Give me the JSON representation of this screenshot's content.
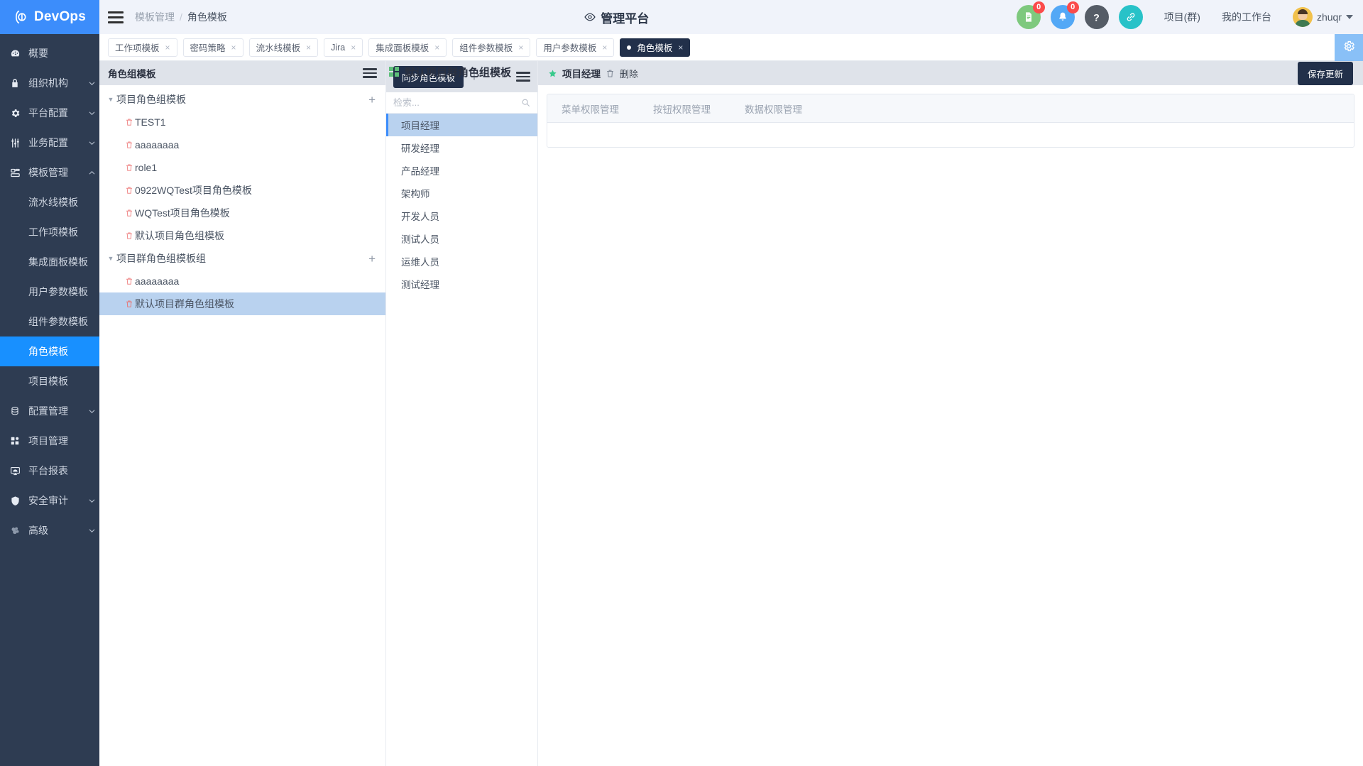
{
  "brand": {
    "name": "DevOps",
    "logo_icon": "devops-logo-icon"
  },
  "header": {
    "menu_icon": "hamburger-icon",
    "breadcrumb": {
      "parent": "模板管理",
      "separator": "/",
      "current": "角色模板"
    },
    "platform_title": "管理平台",
    "platform_icon": "eye-icon",
    "actions": [
      {
        "icon": "document-icon",
        "badge": "0",
        "color": "#7ec97e"
      },
      {
        "icon": "bell-icon",
        "badge": "0",
        "color": "#53a8f6"
      },
      {
        "icon": "question-icon",
        "badge": "",
        "color": "#555c66"
      },
      {
        "icon": "link-icon",
        "badge": "",
        "color": "#28c2c8"
      }
    ],
    "links": [
      "项目(群)",
      "我的工作台"
    ],
    "user": {
      "name": "zhuqr",
      "avatar_icon": "avatar",
      "caret_icon": "chevron-down-icon"
    }
  },
  "sidebar": {
    "items": [
      {
        "label": "概要",
        "icon": "dashboard-icon",
        "arrow": "",
        "level": "top",
        "active": false
      },
      {
        "label": "组织机构",
        "icon": "lock-icon",
        "arrow": "chevron-down-icon",
        "level": "top",
        "active": false
      },
      {
        "label": "平台配置",
        "icon": "gear-icon",
        "arrow": "chevron-down-icon",
        "level": "top",
        "active": false
      },
      {
        "label": "业务配置",
        "icon": "sliders-icon",
        "arrow": "chevron-down-icon",
        "level": "top",
        "active": false
      },
      {
        "label": "模板管理",
        "icon": "template-icon",
        "arrow": "chevron-up-icon",
        "level": "top",
        "active": false
      },
      {
        "label": "流水线模板",
        "icon": "",
        "arrow": "",
        "level": "sub",
        "active": false
      },
      {
        "label": "工作项模板",
        "icon": "",
        "arrow": "",
        "level": "sub",
        "active": false
      },
      {
        "label": "集成面板模板",
        "icon": "",
        "arrow": "",
        "level": "sub",
        "active": false
      },
      {
        "label": "用户参数模板",
        "icon": "",
        "arrow": "",
        "level": "sub",
        "active": false
      },
      {
        "label": "组件参数模板",
        "icon": "",
        "arrow": "",
        "level": "sub",
        "active": false
      },
      {
        "label": "角色模板",
        "icon": "",
        "arrow": "",
        "level": "sub",
        "active": true
      },
      {
        "label": "项目模板",
        "icon": "",
        "arrow": "",
        "level": "sub",
        "active": false
      },
      {
        "label": "配置管理",
        "icon": "database-icon",
        "arrow": "chevron-down-icon",
        "level": "top",
        "active": false
      },
      {
        "label": "项目管理",
        "icon": "grid-icon",
        "arrow": "",
        "level": "top",
        "active": false
      },
      {
        "label": "平台报表",
        "icon": "monitor-icon",
        "arrow": "",
        "level": "top",
        "active": false
      },
      {
        "label": "安全审计",
        "icon": "shield-icon",
        "arrow": "chevron-down-icon",
        "level": "top",
        "active": false
      },
      {
        "label": "高级",
        "icon": "advanced-icon",
        "arrow": "chevron-down-icon",
        "level": "top",
        "active": false
      }
    ]
  },
  "tabstrip": {
    "settings_icon": "gear-icon",
    "tabs": [
      {
        "label": "工作项模板",
        "active": false,
        "closable": true
      },
      {
        "label": "密码策略",
        "active": false,
        "closable": true
      },
      {
        "label": "流水线模板",
        "active": false,
        "closable": true
      },
      {
        "label": "Jira",
        "active": false,
        "closable": true
      },
      {
        "label": "集成面板模板",
        "active": false,
        "closable": true
      },
      {
        "label": "组件参数模板",
        "active": false,
        "closable": true
      },
      {
        "label": "用户参数模板",
        "active": false,
        "closable": true
      },
      {
        "label": "角色模板",
        "active": true,
        "closable": true
      }
    ],
    "close_glyph": "×"
  },
  "tree_pane": {
    "title": "角色组模板",
    "menu_icon": "hamburger-icon",
    "add_glyph": "+",
    "groups": [
      {
        "label": "项目角色组模板",
        "expanded": true,
        "items": [
          {
            "label": "TEST1",
            "selected": false
          },
          {
            "label": "aaaaaaaa",
            "selected": false
          },
          {
            "label": "role1",
            "selected": false
          },
          {
            "label": "0922WQTest项目角色模板",
            "selected": false
          },
          {
            "label": "WQTest项目角色模板",
            "selected": false
          },
          {
            "label": "默认项目角色组模板",
            "selected": false
          }
        ]
      },
      {
        "label": "项目群角色组模板组",
        "expanded": true,
        "items": [
          {
            "label": "aaaaaaaa",
            "selected": false
          },
          {
            "label": "默认项目群角色组模板",
            "selected": true
          }
        ]
      }
    ]
  },
  "section": {
    "icon": "grid-icon",
    "title": "默认项目群角色组模板"
  },
  "role_list": {
    "sync_button": "同步角色模板",
    "add_glyph": "+",
    "menu_icon": "hamburger-icon",
    "search_placeholder": "检索...",
    "search_value": "",
    "search_icon": "search-icon",
    "roles": [
      {
        "label": "项目经理",
        "selected": true
      },
      {
        "label": "研发经理",
        "selected": false
      },
      {
        "label": "产品经理",
        "selected": false
      },
      {
        "label": "架构师",
        "selected": false
      },
      {
        "label": "开发人员",
        "selected": false
      },
      {
        "label": "测试人员",
        "selected": false
      },
      {
        "label": "运维人员",
        "selected": false
      },
      {
        "label": "测试经理",
        "selected": false
      }
    ]
  },
  "detail": {
    "star_icon": "star-icon",
    "role_name": "项目经理",
    "delete_icon": "trash-icon",
    "delete_label": "删除",
    "save_label": "保存更新",
    "tabs": [
      {
        "label": "菜单权限管理",
        "active": true
      },
      {
        "label": "按钮权限管理",
        "active": false
      },
      {
        "label": "数据权限管理",
        "active": false
      }
    ]
  },
  "colors": {
    "brand_blue": "#3c8dfb",
    "sidebar_bg": "#2e3c52",
    "active_nav": "#1890ff",
    "selection": "#b9d2ef",
    "dark_button": "#22304a",
    "badge_red": "#fb4b4b",
    "trash_red": "#f08a8a",
    "star_green": "#37c98b"
  }
}
